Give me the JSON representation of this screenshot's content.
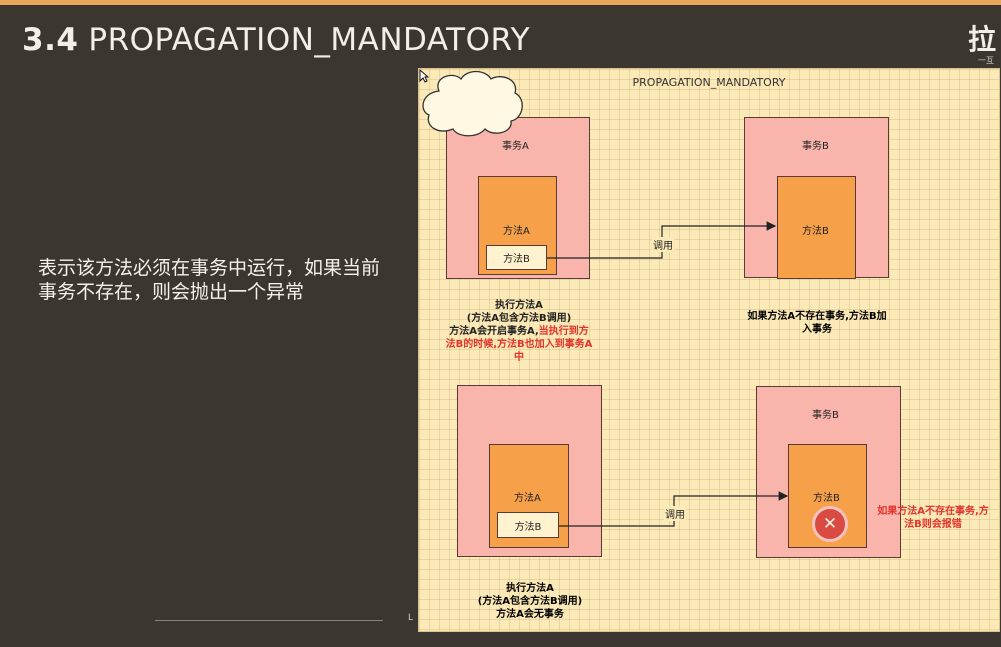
{
  "slide": {
    "number": "3.4",
    "title": "PROPAGATION_MANDATORY",
    "logo": "拉",
    "logo_sub": "一互",
    "description": "表示该方法必须在事务中运行，如果当前事务不存在，则会抛出一个异常",
    "bottom_mark": "L"
  },
  "diagram": {
    "title": "PROPAGATION_MANDATORY",
    "top_left": {
      "outer_label": "事务A",
      "inner_label": "方法A",
      "small_label": "方法B",
      "note_black": "执行方法A\n(方法A包含方法B调用)\n方法A会开启事务A,",
      "note_red": "当执行到方法B的时候,方法B也加入到事务A中"
    },
    "top_right": {
      "outer_label": "事务B",
      "inner_label": "方法B",
      "note_red": "如果方法A不存在事务,方法B加入事务"
    },
    "arrow_top_label": "调用",
    "bottom_left": {
      "inner_label": "方法A",
      "small_label": "方法B",
      "note_black": "执行方法A\n(方法A包含方法B调用)\n方法A会无事务"
    },
    "bottom_right": {
      "outer_label": "事务B",
      "inner_label": "方法B",
      "cloud_note": "如果方法A不存在事务,方法B则会报错"
    },
    "arrow_bottom_label": "调用",
    "colors": {
      "outer_fill": "#f9b4ac",
      "inner_fill": "#f7a04a",
      "small_fill": "#fff3cf",
      "note_red": "#e2342b",
      "panel_bg": "#fbe9b8"
    }
  }
}
